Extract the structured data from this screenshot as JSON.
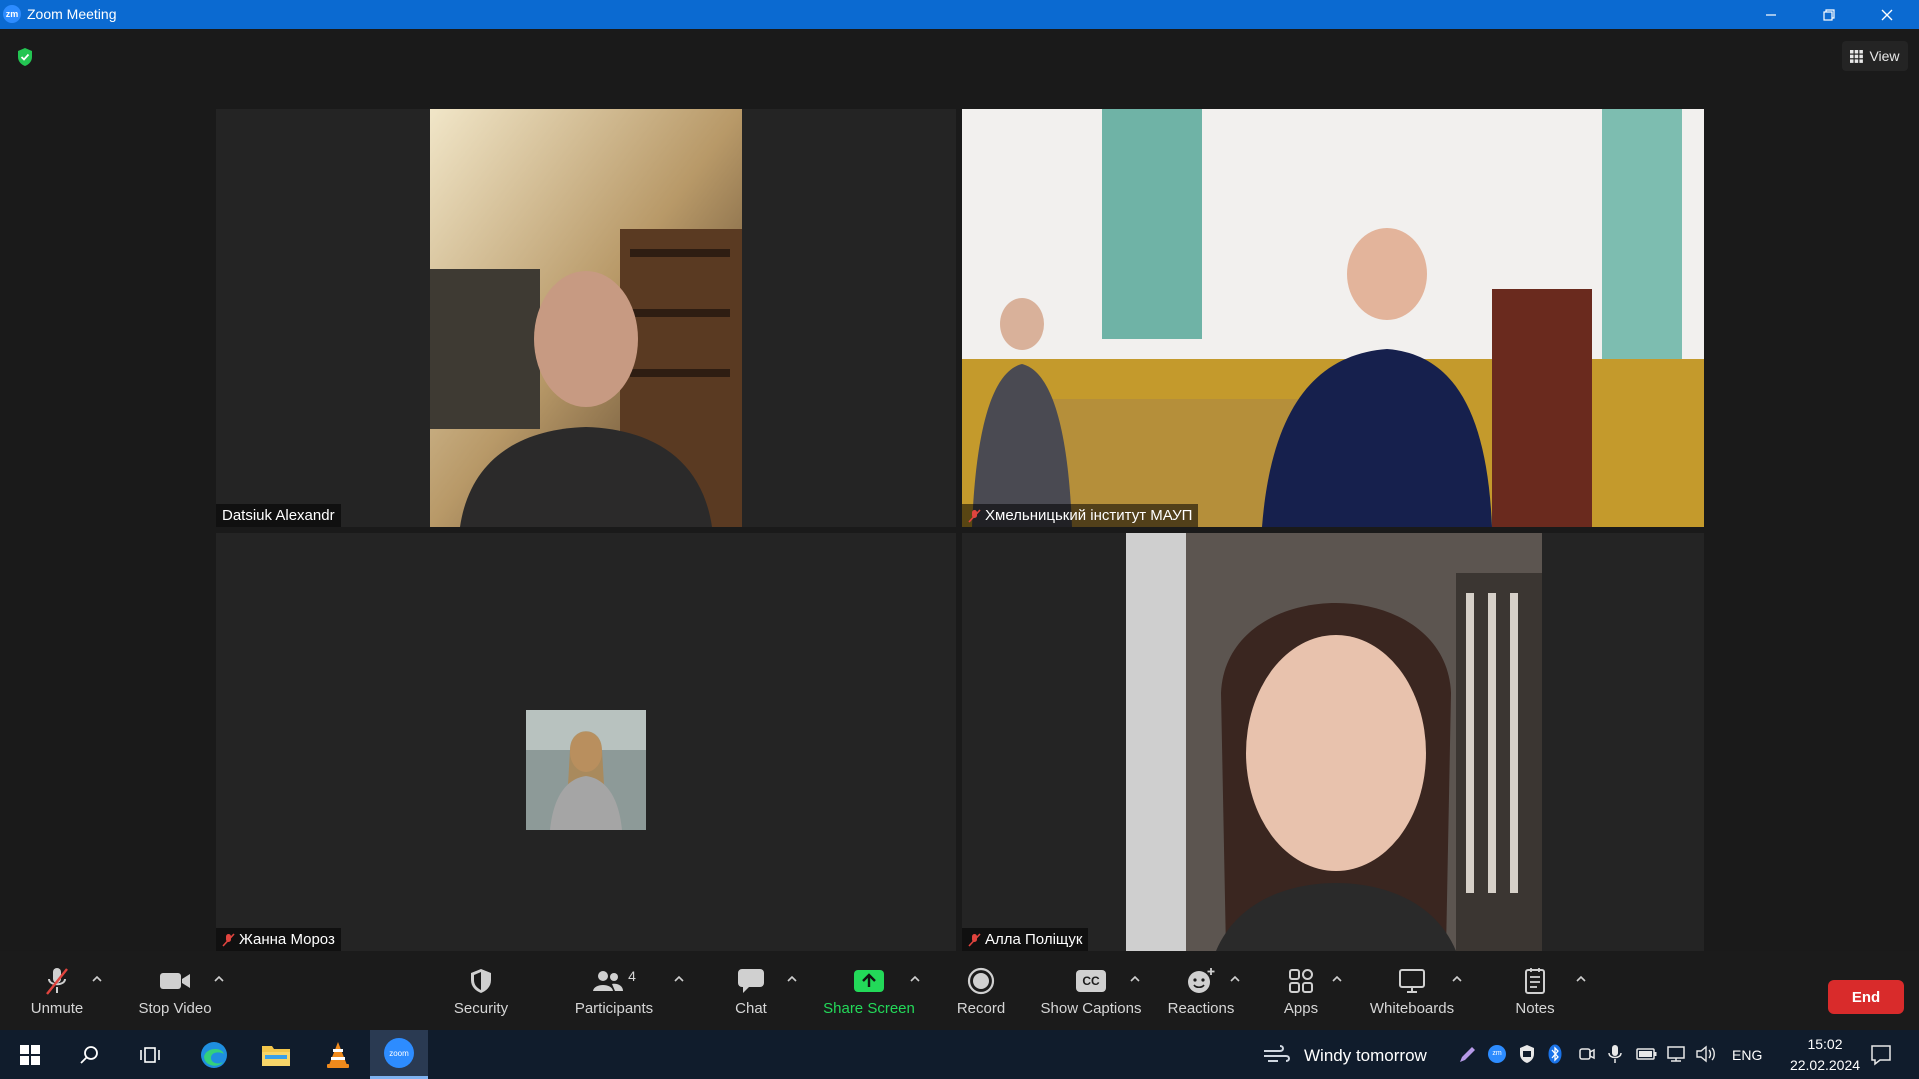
{
  "window": {
    "title": "Zoom Meeting",
    "logo_text": "zm"
  },
  "header": {
    "view_label": "View"
  },
  "participants": [
    {
      "name": "Datsiuk Alexandr",
      "muted": false,
      "active_speaker": false
    },
    {
      "name": "Хмельницький інститут МАУП",
      "muted": true,
      "active_speaker": true
    },
    {
      "name": "Жанна Мороз",
      "muted": true,
      "active_speaker": false
    },
    {
      "name": "Алла Поліщук",
      "muted": true,
      "active_speaker": false
    }
  ],
  "toolbar": {
    "unmute": "Unmute",
    "stop_video": "Stop Video",
    "security": "Security",
    "participants": "Participants",
    "participants_count": "4",
    "chat": "Chat",
    "share_screen": "Share Screen",
    "record": "Record",
    "show_captions": "Show Captions",
    "captions_badge": "CC",
    "reactions": "Reactions",
    "apps": "Apps",
    "whiteboards": "Whiteboards",
    "notes": "Notes",
    "end": "End"
  },
  "taskbar": {
    "weather": "Windy tomorrow",
    "language": "ENG",
    "time": "15:02",
    "date": "22.02.2024",
    "zoom_app_label": "zoom"
  },
  "colors": {
    "title_bar": "#0b6ad1",
    "active_speaker_border": "#d9e46a",
    "share_green": "#23d959",
    "end_red": "#d92b2b",
    "mute_red": "#e0443e"
  }
}
